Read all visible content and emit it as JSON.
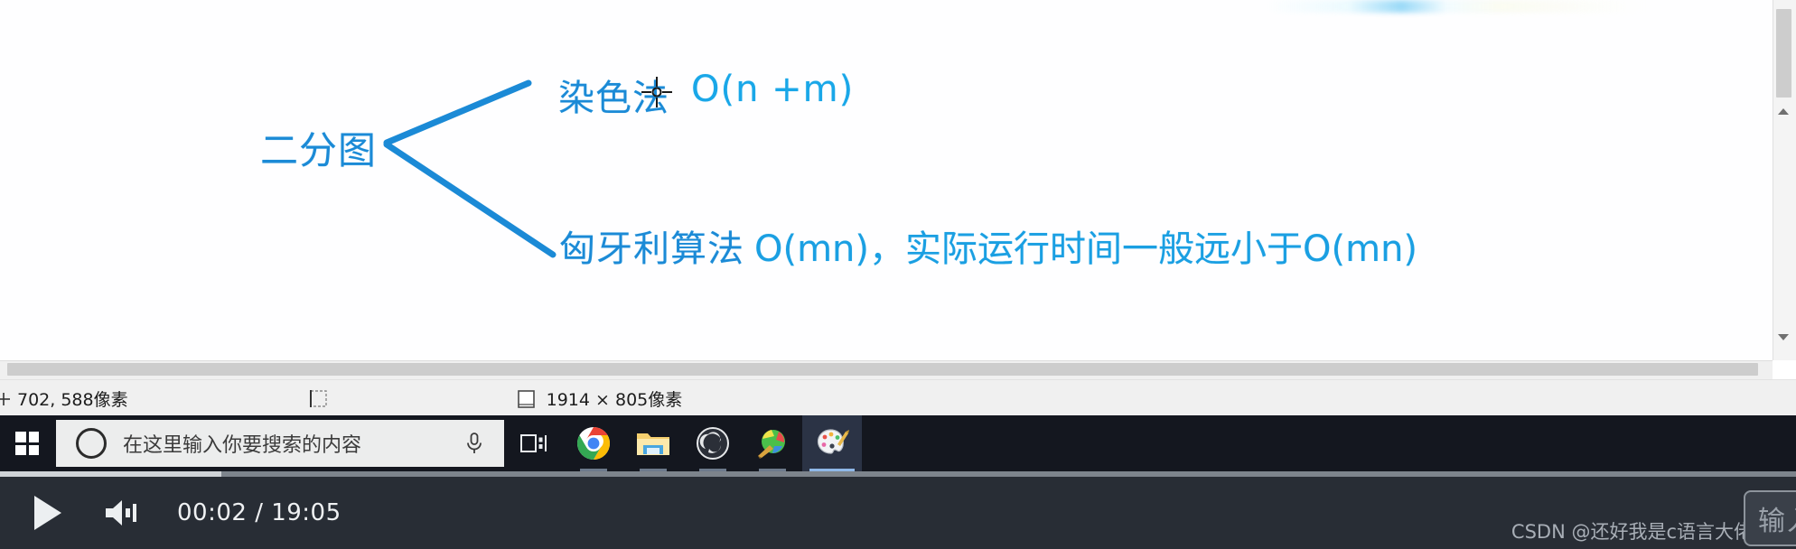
{
  "canvas": {
    "diagram": {
      "root_label": "二分图",
      "branches": [
        {
          "label": "染色法",
          "complexity": "O(n +m)"
        },
        {
          "label": "匈牙利算法",
          "complexity": "O(mn)，实际运行时间一般远小于O(mn)"
        }
      ],
      "ink_color": "#1b8ad6"
    },
    "cursor": "crosshair-cursor"
  },
  "status_bar": {
    "cursor_position": "702, 588像素",
    "selection_size": "",
    "image_size": "1914 × 805像素",
    "icons": {
      "position": "cursor-position-icon",
      "selection": "selection-size-icon",
      "size": "image-size-icon"
    }
  },
  "taskbar": {
    "start_label": "start-button",
    "search": {
      "placeholder": "在这里输入你要搜索的内容",
      "value": ""
    },
    "items": [
      {
        "name": "task-view",
        "label": "任务视图"
      },
      {
        "name": "chrome",
        "label": "Google Chrome"
      },
      {
        "name": "file-explorer",
        "label": "文件资源管理器"
      },
      {
        "name": "obs-studio",
        "label": "OBS Studio"
      },
      {
        "name": "earth-app",
        "label": "地图"
      },
      {
        "name": "paint",
        "label": "画图"
      }
    ],
    "active_item": "paint"
  },
  "player": {
    "current_time": "00:02",
    "total_time": "19:05",
    "time_display": "00:02 / 19:05",
    "progress_percent": 12,
    "play_state": "paused",
    "volume_state": "on"
  },
  "watermark": {
    "text": "CSDN @还好我是c语言大佬"
  },
  "ime_overlay": {
    "text": "输入"
  },
  "colors": {
    "ink": "#1b8ad6",
    "ink_light": "#19a7e8",
    "taskbar_bg": "#14171f",
    "player_bg": "#282d35",
    "status_bg": "#f0f0f0"
  }
}
